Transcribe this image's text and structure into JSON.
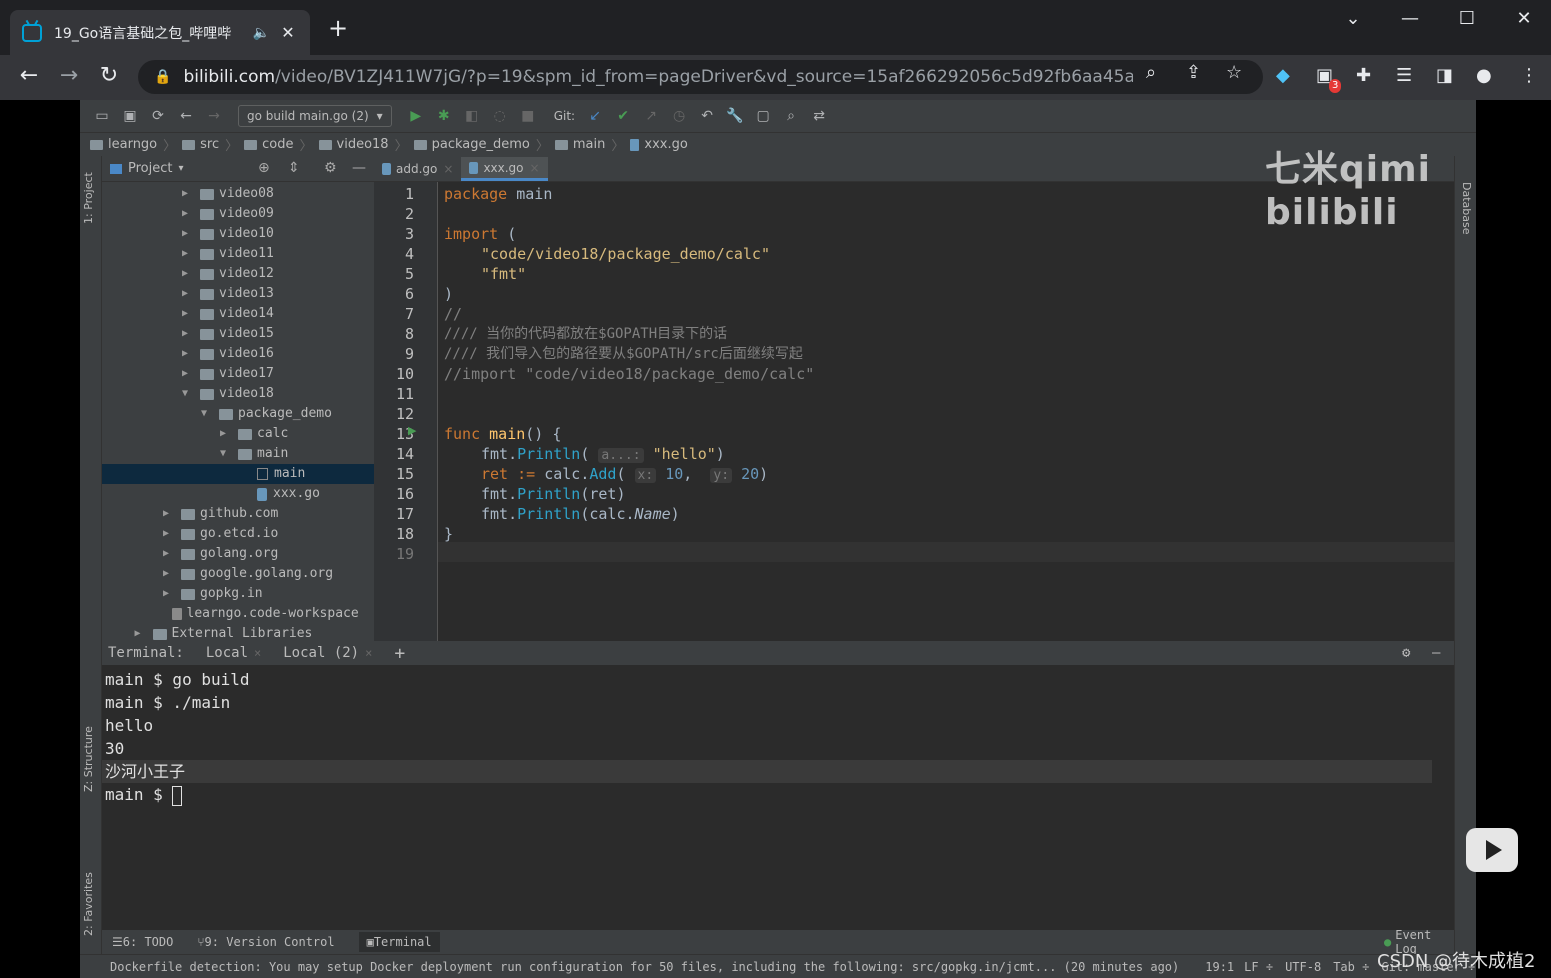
{
  "browser": {
    "tab_title": "19_Go语言基础之包_哔哩哔",
    "speaker_icon": "speaker-icon",
    "close_glyph": "✕",
    "new_tab_glyph": "+",
    "url_host": "bilibili.com",
    "url_rest": "/video/BV1ZJ411W7jG/?p=19&spm_id_from=pageDriver&vd_source=15af266292056c5d92fb6aa45a...",
    "extension_badge": "3"
  },
  "ide": {
    "run_config": "go build main.go (2)",
    "git_label": "Git:",
    "breadcrumb": [
      "learngo",
      "src",
      "code",
      "video18",
      "package_demo",
      "main",
      "xxx.go"
    ],
    "project_label": "Project",
    "left_strip_labels": [
      "1: Project",
      "Z: Structure",
      "2: Favorites"
    ],
    "right_strip_label": "Database",
    "tree": [
      {
        "label": "video08",
        "indent": 2,
        "kind": "folder",
        "arrow": "▶"
      },
      {
        "label": "video09",
        "indent": 2,
        "kind": "folder",
        "arrow": "▶"
      },
      {
        "label": "video10",
        "indent": 2,
        "kind": "folder",
        "arrow": "▶"
      },
      {
        "label": "video11",
        "indent": 2,
        "kind": "folder",
        "arrow": "▶"
      },
      {
        "label": "video12",
        "indent": 2,
        "kind": "folder",
        "arrow": "▶"
      },
      {
        "label": "video13",
        "indent": 2,
        "kind": "folder",
        "arrow": "▶"
      },
      {
        "label": "video14",
        "indent": 2,
        "kind": "folder",
        "arrow": "▶"
      },
      {
        "label": "video15",
        "indent": 2,
        "kind": "folder",
        "arrow": "▶"
      },
      {
        "label": "video16",
        "indent": 2,
        "kind": "folder",
        "arrow": "▶"
      },
      {
        "label": "video17",
        "indent": 2,
        "kind": "folder",
        "arrow": "▶"
      },
      {
        "label": "video18",
        "indent": 2,
        "kind": "folder",
        "arrow": "▼"
      },
      {
        "label": "package_demo",
        "indent": 3,
        "kind": "folder",
        "arrow": "▼"
      },
      {
        "label": "calc",
        "indent": 4,
        "kind": "folder",
        "arrow": "▶"
      },
      {
        "label": "main",
        "indent": 4,
        "kind": "folder",
        "arrow": "▼"
      },
      {
        "label": "main",
        "indent": 5,
        "kind": "bin",
        "arrow": ""
      },
      {
        "label": "xxx.go",
        "indent": 5,
        "kind": "go",
        "arrow": ""
      },
      {
        "label": "github.com",
        "indent": 1,
        "kind": "folder",
        "arrow": "▶"
      },
      {
        "label": "go.etcd.io",
        "indent": 1,
        "kind": "folder",
        "arrow": "▶"
      },
      {
        "label": "golang.org",
        "indent": 1,
        "kind": "folder",
        "arrow": "▶"
      },
      {
        "label": "google.golang.org",
        "indent": 1,
        "kind": "folder",
        "arrow": "▶"
      },
      {
        "label": "gopkg.in",
        "indent": 1,
        "kind": "folder",
        "arrow": "▶"
      },
      {
        "label": "learngo.code-workspace",
        "indent": 0.5,
        "kind": "ws",
        "arrow": ""
      },
      {
        "label": "External Libraries",
        "indent": -0.5,
        "kind": "lib",
        "arrow": "▶"
      }
    ],
    "editor_tabs": [
      {
        "label": "add.go",
        "active": false
      },
      {
        "label": "xxx.go",
        "active": true
      }
    ],
    "line_numbers": [
      "1",
      "2",
      "3",
      "4",
      "5",
      "6",
      "7",
      "8",
      "9",
      "10",
      "11",
      "12",
      "13",
      "14",
      "15",
      "16",
      "17",
      "18",
      "19"
    ],
    "code": {
      "l1_kw": "package",
      "l1_rest": " main",
      "l3_kw": "import",
      "l3_rest": " (",
      "l4": "\"code/video18/package_demo/calc\"",
      "l5": "\"fmt\"",
      "l6": ")",
      "l7": "//",
      "l8": "//// 当你的代码都放在$GOPATH目录下的话",
      "l9": "//// 我们导入包的路径要从$GOPATH/src后面继续写起",
      "l10": "//import \"code/video18/package_demo/calc\"",
      "l13_kw": "func",
      "l13_fn": " main",
      "l13_rest": "() {",
      "l14_pre": "fmt.",
      "l14_call": "Println",
      "l14_hint": "a...:",
      "l14_str": "\"hello\"",
      "l15_var": "ret",
      "l15_op": " := ",
      "l15_pre": "calc.",
      "l15_call": "Add",
      "l15_hx": "x:",
      "l15_n1": "10",
      "l15_hy": "y:",
      "l15_n2": "20",
      "l16_pre": "fmt.",
      "l16_call": "Println",
      "l16_arg": "(ret)",
      "l17_pre": "fmt.",
      "l17_call": "Println",
      "l17_arg": "calc.",
      "l17_name": "Name",
      "l18": "}"
    },
    "watermark": "七米qimi  bilibili",
    "terminal": {
      "label": "Terminal:",
      "tabs": [
        "Local",
        "Local (2)"
      ],
      "lines": [
        "main $ go build",
        "main $ ./main",
        "hello",
        "30",
        "沙河小王子",
        "main $ "
      ]
    },
    "tool_tabs": [
      "6: TODO",
      "9: Version Control",
      "Terminal"
    ],
    "event_log": "Event Log",
    "status_message": "Dockerfile detection: You may setup Docker deployment run configuration for 50 files, including the following: src/gopkg.in/jcmt... (20 minutes ago)",
    "status_right": [
      "19:1",
      "LF ÷",
      "UTF-8",
      "Tab ÷",
      "Git: master ÷"
    ]
  },
  "overlay": {
    "csdn": "CSDN @待木成植2"
  },
  "colors": {
    "accent": "#4a88c7",
    "keyword": "#cc7832",
    "string": "#6a8759"
  }
}
